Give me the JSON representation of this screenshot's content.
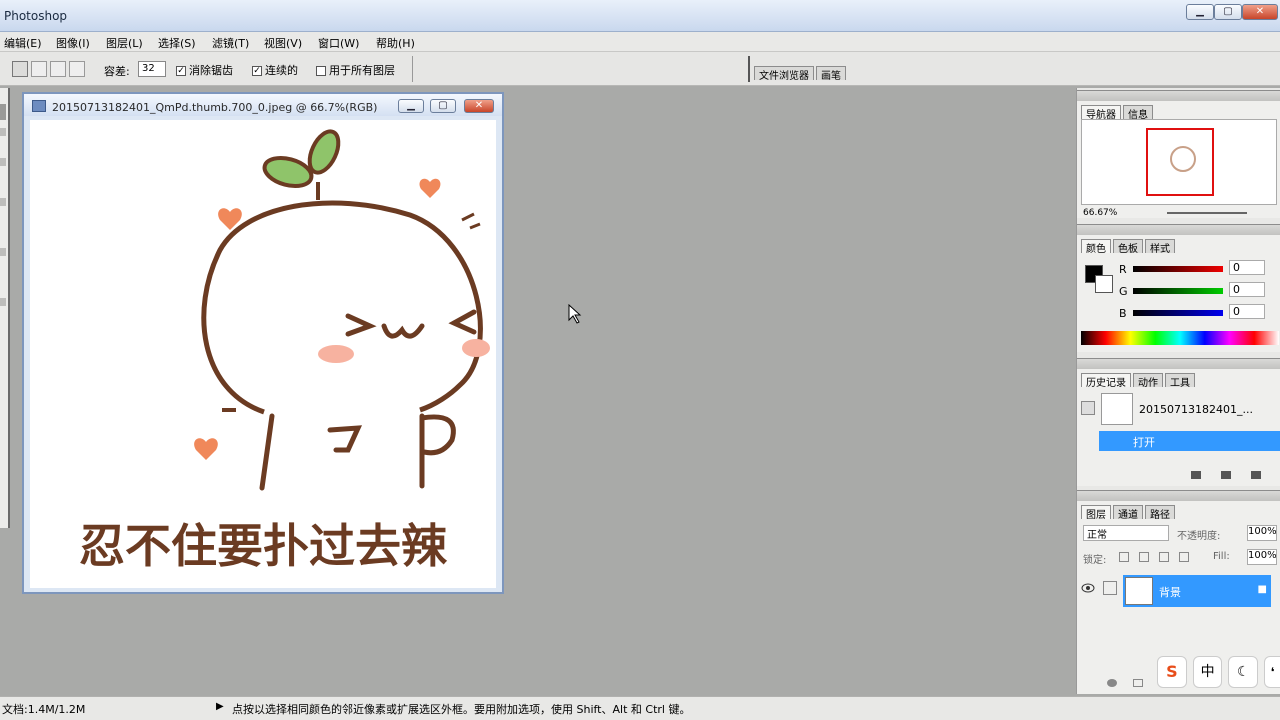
{
  "app": {
    "title": "Photoshop"
  },
  "menu": [
    "编辑(E)",
    "图像(I)",
    "图层(L)",
    "选择(S)",
    "滤镜(T)",
    "视图(V)",
    "窗口(W)",
    "帮助(H)"
  ],
  "options": {
    "tolerance_label": "容差:",
    "tolerance_value": "32",
    "anti_alias": "消除锯齿",
    "contiguous": "连续的",
    "sample_all": "用于所有图层"
  },
  "docked_tabs": {
    "file_browser": "文件浏览器",
    "brushes": "画笔"
  },
  "document": {
    "title": "20150713182401_QmPd.thumb.700_0.jpeg @ 66.7%(RGB)",
    "caption": "忍不住要扑过去辣",
    "face": ">ω<"
  },
  "navigator": {
    "tab1": "导航器",
    "tab2": "信息",
    "zoom": "66.67%"
  },
  "color": {
    "tab1": "颜色",
    "tab2": "色板",
    "tab3": "样式",
    "r_label": "R",
    "g_label": "G",
    "b_label": "B",
    "r_value": "0",
    "g_value": "0",
    "b_value": "0"
  },
  "history": {
    "tab1": "历史记录",
    "tab2": "动作",
    "tab3": "工具",
    "snapshot_name": "20150713182401_...",
    "step": "打开"
  },
  "layers": {
    "tab1": "图层",
    "tab2": "通道",
    "tab3": "路径",
    "blend_mode": "正常",
    "opacity_label": "不透明度:",
    "opacity_value": "100%",
    "lock_label": "锁定:",
    "fill_label": "Fill:",
    "fill_value": "100%",
    "layer_name": "背景"
  },
  "status": {
    "doc_size": "文档:1.4M/1.2M",
    "hint": "点按以选择相同颜色的邻近像素或扩展选区外框。要用附加选项，使用 Shift、Alt 和 Ctrl 键。"
  },
  "tray": {
    "input_mode": "中"
  },
  "colors": {
    "sprout": "#8fc46a",
    "outline": "#6b3b22",
    "heart": "#f0885a",
    "blush": "#f7b2a0",
    "selection": "#3399ff"
  }
}
